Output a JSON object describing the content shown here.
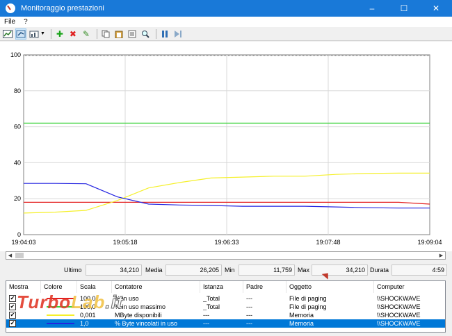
{
  "window": {
    "title": "Monitoraggio prestazioni",
    "minimize": "–",
    "maximize": "☐",
    "close": "✕"
  },
  "menu": [
    "File",
    "?"
  ],
  "chart_data": {
    "type": "line",
    "x": [
      "19:04:03",
      "19:05:18",
      "19:06:33",
      "19:07:48",
      "19:09:04"
    ],
    "ylim": [
      0,
      100
    ],
    "yticks": [
      "100",
      "80",
      "60",
      "40",
      "20",
      "0"
    ],
    "series": [
      {
        "name": "% in uso",
        "color": "#e32020",
        "values": [
          18,
          18,
          18,
          18,
          18,
          18,
          18,
          18,
          18,
          18,
          18,
          18,
          18,
          17
        ]
      },
      {
        "name": "% in uso massimo",
        "color": "#3cd33c",
        "values": [
          62,
          62,
          62,
          62,
          62,
          62,
          62,
          62,
          62,
          62,
          62,
          62,
          62,
          62
        ]
      },
      {
        "name": "MByte disponibili",
        "color": "#f5f02a",
        "values": [
          12,
          12.5,
          13.5,
          19,
          26,
          29,
          31.5,
          32,
          32.5,
          32.5,
          33.5,
          34,
          34.2,
          34.2
        ]
      },
      {
        "name": "% Byte vincolati in uso",
        "color": "#2424e0",
        "values": [
          28.5,
          28.5,
          28.3,
          21,
          17,
          16.5,
          16.2,
          15.8,
          15.8,
          15.8,
          15.4,
          15,
          14.8,
          14.8
        ]
      }
    ]
  },
  "stats": {
    "ultimo_label": "Ultimo",
    "ultimo": "34,210",
    "media_label": "Media",
    "media": "26,205",
    "min_label": "Min",
    "min": "11,759",
    "max_label": "Max",
    "max": "34,210",
    "durata_label": "Durata",
    "durata": "4:59"
  },
  "columns": [
    "Mostra",
    "Colore",
    "Scala",
    "Contatore",
    "Istanza",
    "Padre",
    "Oggetto",
    "Computer"
  ],
  "rows": [
    {
      "scala": "100,0",
      "contatore": "% in uso",
      "istanza": "_Total",
      "padre": "---",
      "oggetto": "File di paging",
      "computer": "\\\\SHOCKWAVE",
      "color": "#e32020"
    },
    {
      "scala": "100,0",
      "contatore": "% in uso massimo",
      "istanza": "_Total",
      "padre": "---",
      "oggetto": "File di paging",
      "computer": "\\\\SHOCKWAVE",
      "color": "#3cd33c"
    },
    {
      "scala": "0,001",
      "contatore": "MByte disponibili",
      "istanza": "---",
      "padre": "---",
      "oggetto": "Memoria",
      "computer": "\\\\SHOCKWAVE",
      "color": "#f5f02a"
    },
    {
      "scala": "1,0",
      "contatore": "% Byte vincolati in uso",
      "istanza": "---",
      "padre": "---",
      "oggetto": "Memoria",
      "computer": "\\\\SHOCKWAVE",
      "color": "#2424e0"
    }
  ],
  "watermark": {
    "a": "Turbo",
    "b": "Lab",
    "c": ".it"
  }
}
